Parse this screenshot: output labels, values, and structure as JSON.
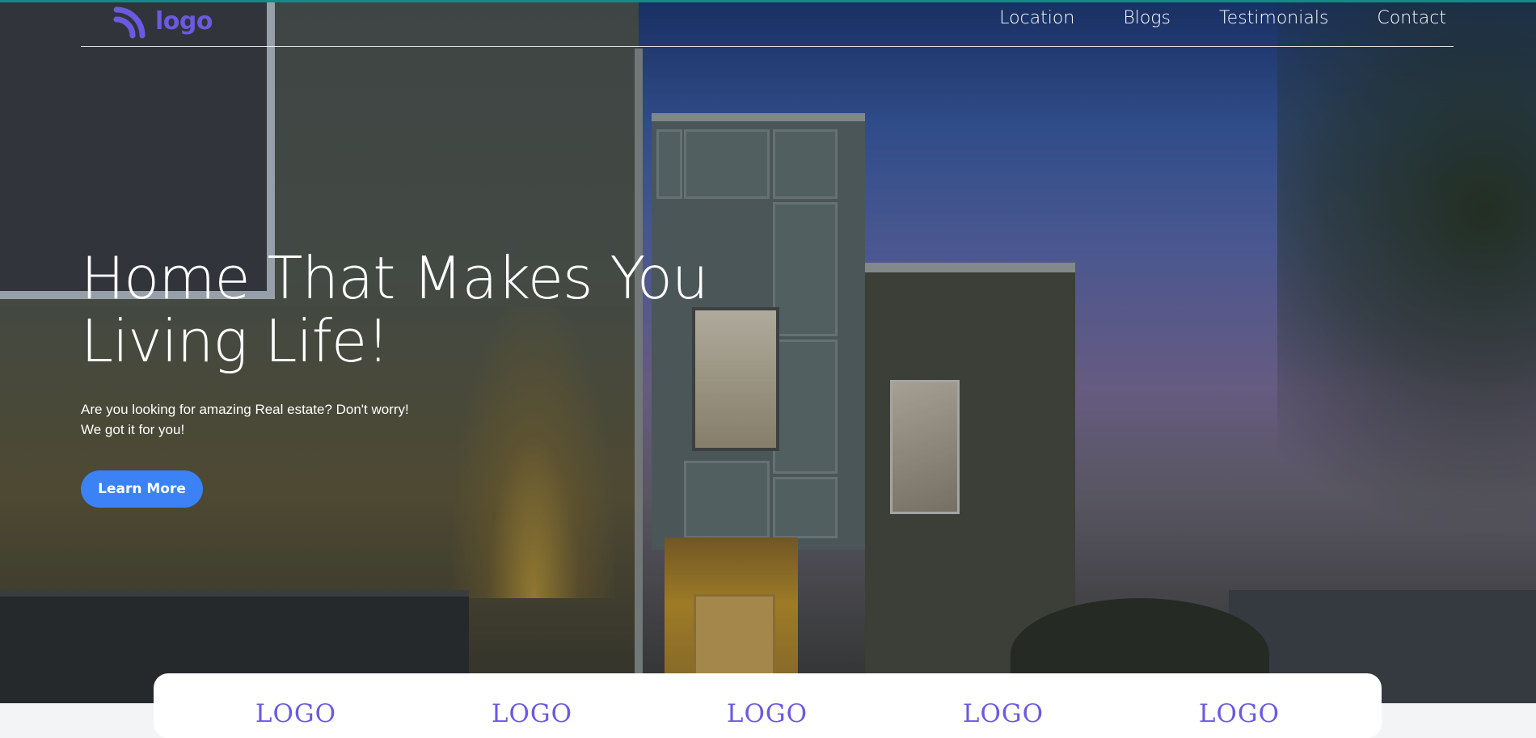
{
  "header": {
    "logo_text": "logo",
    "logo_icon": "signal-arcs-icon",
    "nav": [
      "Location",
      "Blogs",
      "Testimonials",
      "Contact"
    ]
  },
  "hero": {
    "title_line1": "Home That Makes You",
    "title_line2": "Living Life!",
    "subtitle_line1": "Are you looking for amazing Real estate? Don't worry!",
    "subtitle_line2": "We got it for you!",
    "cta_label": "Learn More"
  },
  "partners": {
    "logos": [
      "LOGO",
      "LOGO",
      "LOGO",
      "LOGO",
      "LOGO"
    ]
  },
  "colors": {
    "brand": "#6a5ae0",
    "cta": "#3b82f6",
    "top_accent": "#0d8d86"
  }
}
